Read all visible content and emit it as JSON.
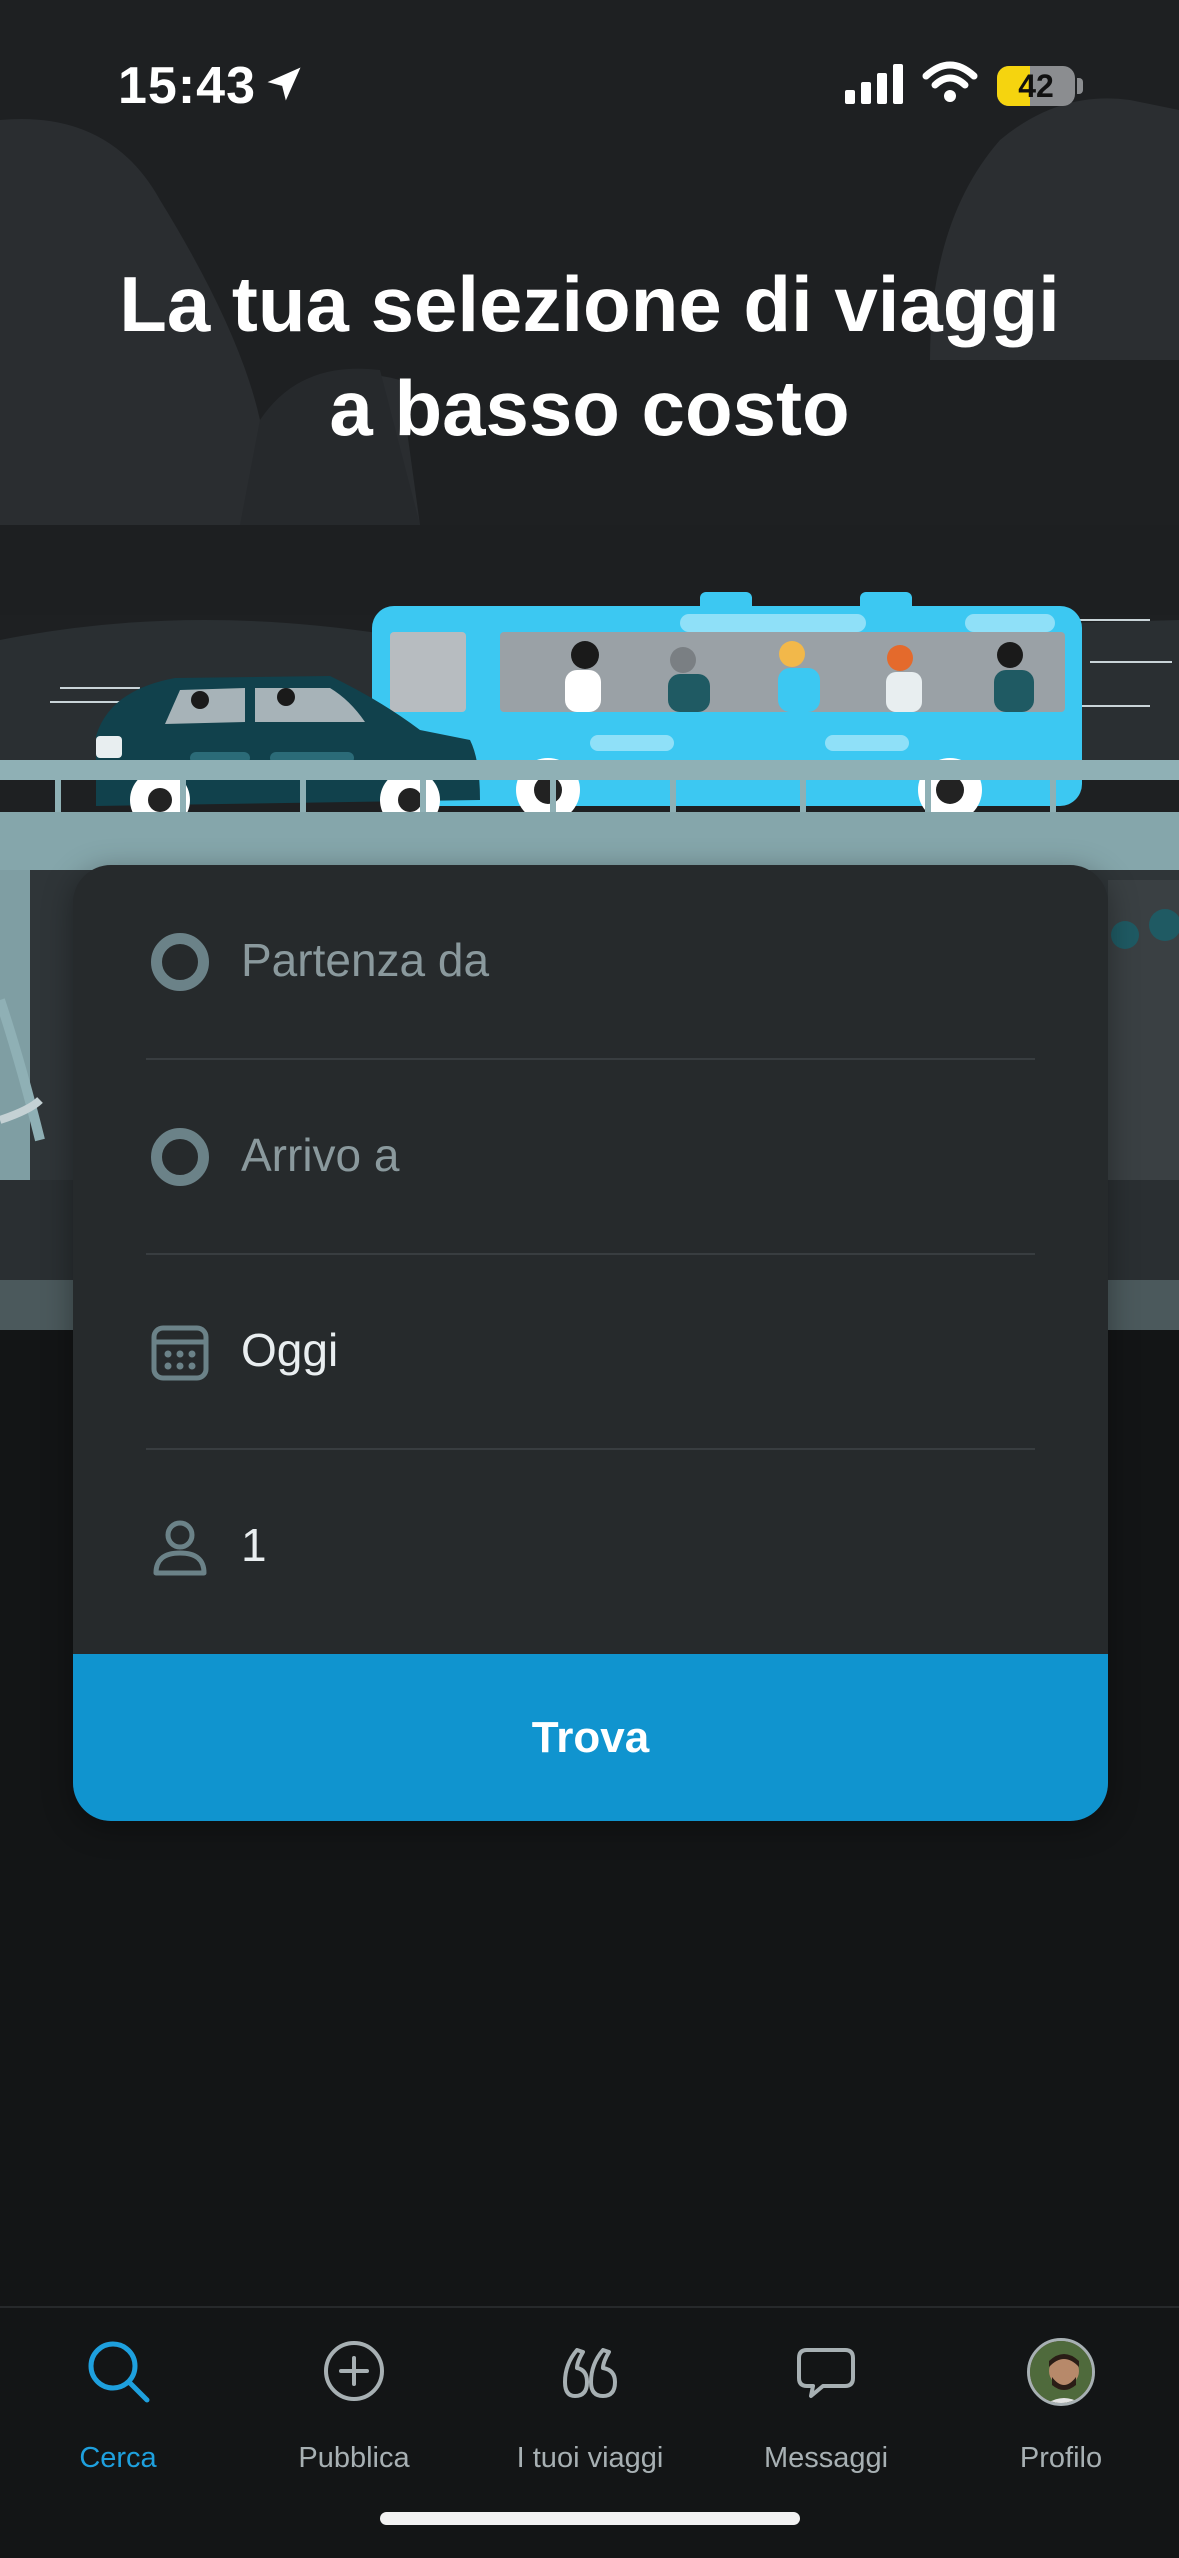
{
  "status_bar": {
    "time": "15:43",
    "battery": "42"
  },
  "hero": {
    "title_line1": "La tua selezione di viaggi",
    "title_line2": "a basso costo"
  },
  "search": {
    "from_placeholder": "Partenza da",
    "to_placeholder": "Arrivo a",
    "date": "Oggi",
    "passengers": "1",
    "find_label": "Trova"
  },
  "tabs": [
    {
      "label": "Cerca",
      "icon": "search-icon",
      "active": true
    },
    {
      "label": "Pubblica",
      "icon": "plus-circle-icon"
    },
    {
      "label": "I tuoi viaggi",
      "icon": "quotes-icon"
    },
    {
      "label": "Messaggi",
      "icon": "chat-icon"
    },
    {
      "label": "Profilo",
      "icon": "avatar"
    }
  ],
  "colors": {
    "accent": "#1094cf",
    "bus": "#3cc8f2",
    "car": "#11414c",
    "background": "#131516"
  }
}
